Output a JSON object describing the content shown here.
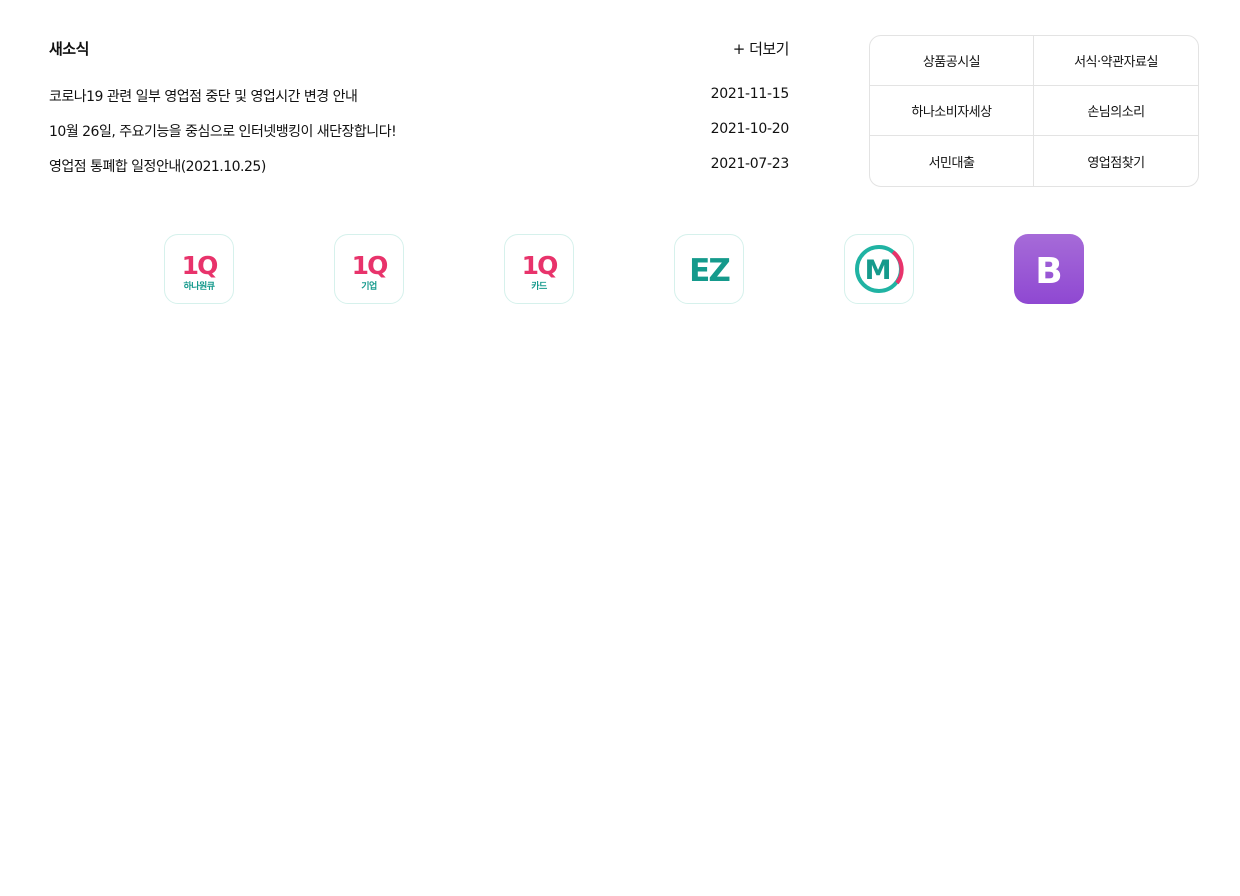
{
  "news": {
    "title": "새소식",
    "more_label": "+ 더보기",
    "items": [
      {
        "text": "코로나19 관련 일부 영업점 중단 및 영업시간 변경 안내",
        "date": "2021-11-15"
      },
      {
        "text": "10월 26일, 주요기능을 중심으로 인터넷뱅킹이 새단장합니다!",
        "date": "2021-10-20"
      },
      {
        "text": "영업점 통폐합 일정안내(2021.10.25)",
        "date": "2021-07-23"
      }
    ]
  },
  "quick_links": [
    "상품공시실",
    "서식·약관자료실",
    "하나소비자세상",
    "손님의소리",
    "서민대출",
    "영업점찾기"
  ],
  "apps": [
    {
      "icon": "1q-hana-app-icon",
      "logo": "1Q",
      "label": "하나원큐"
    },
    {
      "icon": "1q-business-app-icon",
      "logo": "1Q",
      "label": "기업"
    },
    {
      "icon": "1q-card-app-icon",
      "logo": "1Q",
      "label": "카드"
    },
    {
      "icon": "ez-app-icon",
      "logo": "EZ"
    },
    {
      "icon": "m-app-icon",
      "logo": "M"
    },
    {
      "icon": "b-app-icon",
      "logo": "B"
    }
  ],
  "colors": {
    "teal": "#159a8c",
    "pink": "#e8336b",
    "purple": "#9a55d6",
    "border": "#e3e3e3"
  }
}
